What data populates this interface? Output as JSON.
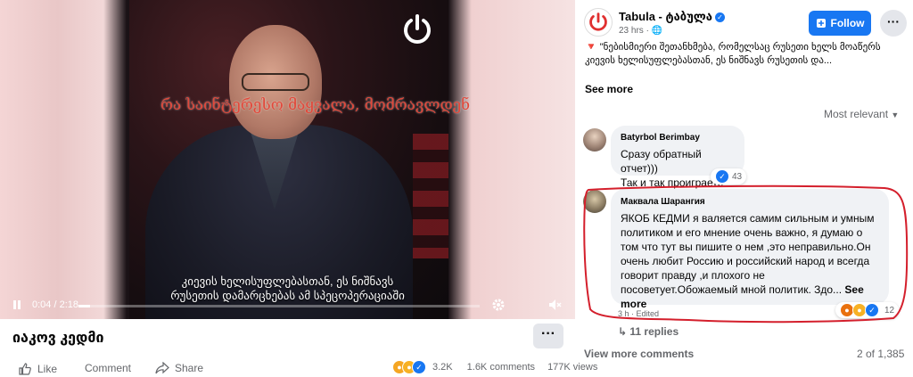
{
  "video": {
    "overlay_caption": "რა საინტერესო მაყვალა, მომრავლდენ",
    "subtitle_line1": "კიევის ხელისუფლებასთან, ეს ნიშნავს",
    "subtitle_line2": "რუსეთის დამარცხებას ამ სპეცოპერაციაში",
    "time": "0:04 / 2:18",
    "progress": 0.029
  },
  "video_info": {
    "title": "იაკოვ კედმი",
    "more": "···",
    "like_label": "Like",
    "comment_label": "Comment",
    "share_label": "Share",
    "reaction_count": "3.2K",
    "comments_count": "1.6K comments",
    "views_count": "177K views"
  },
  "post": {
    "page_name": "Tabula - ტაბულა",
    "time": "23 hrs",
    "follow_label": "Follow",
    "more": "···",
    "text": "🔻 \"ნებისმიერი შეთანხმება, რომელსაც რუსეთი ხელს მოაწერს კიევის ხელისუფლებასთან, ეს ნიშნავს რუსეთის და...",
    "see_more": "See more",
    "sort_label": "Most relevant"
  },
  "comments": [
    {
      "author": "Batyrbol Berimbay",
      "line1": "Сразу обратный отчет)))",
      "line2": "Так и так проиграете",
      "reactions": "43"
    },
    {
      "author": "Маквала Шарангия",
      "text": "ЯКОБ КЕДМИ я валяется самим сильным и умным политиком и его мнение очень важно, я думаю о том что тут вы пишите о нем ,это неправильно.Он очень любит Россию и российский народ и всегда говорит правду ,и плохого не посоветует.Обожаемый мной политик. Здо...",
      "see_more": "See more",
      "time": "3 h",
      "edited": "Edited",
      "reactions": "12"
    }
  ],
  "replies_label": "11 replies",
  "view_more": "View more comments",
  "pager": "2 of 1,385",
  "colors": {
    "brand_blue": "#1877f2",
    "annotation_red": "#d41f2c",
    "tabula_red": "#e03030"
  }
}
